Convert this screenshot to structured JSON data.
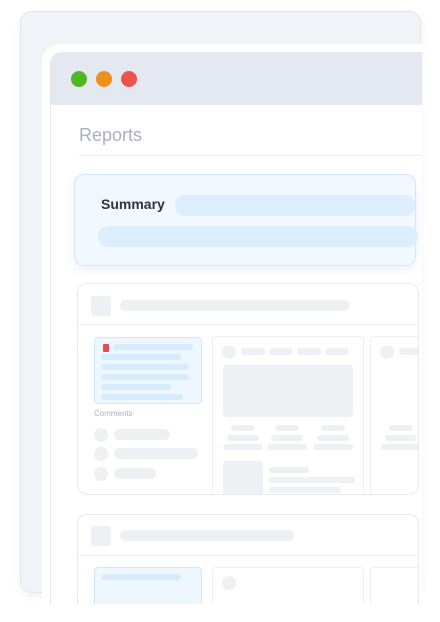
{
  "window": {
    "controls": [
      {
        "name": "close",
        "color": "#52b526"
      },
      {
        "name": "minimize",
        "color": "#f0901c"
      },
      {
        "name": "maximize",
        "color": "#ef5350"
      }
    ]
  },
  "page": {
    "title": "Reports",
    "summary_label": "Summary"
  },
  "card1": {
    "comments_label": "Comments",
    "file_icon": "pdf-file-icon"
  },
  "colors": {
    "accent_light": "#dceefd",
    "summary_bg": "#f1f8ff",
    "placeholder": "#eef0f4"
  }
}
